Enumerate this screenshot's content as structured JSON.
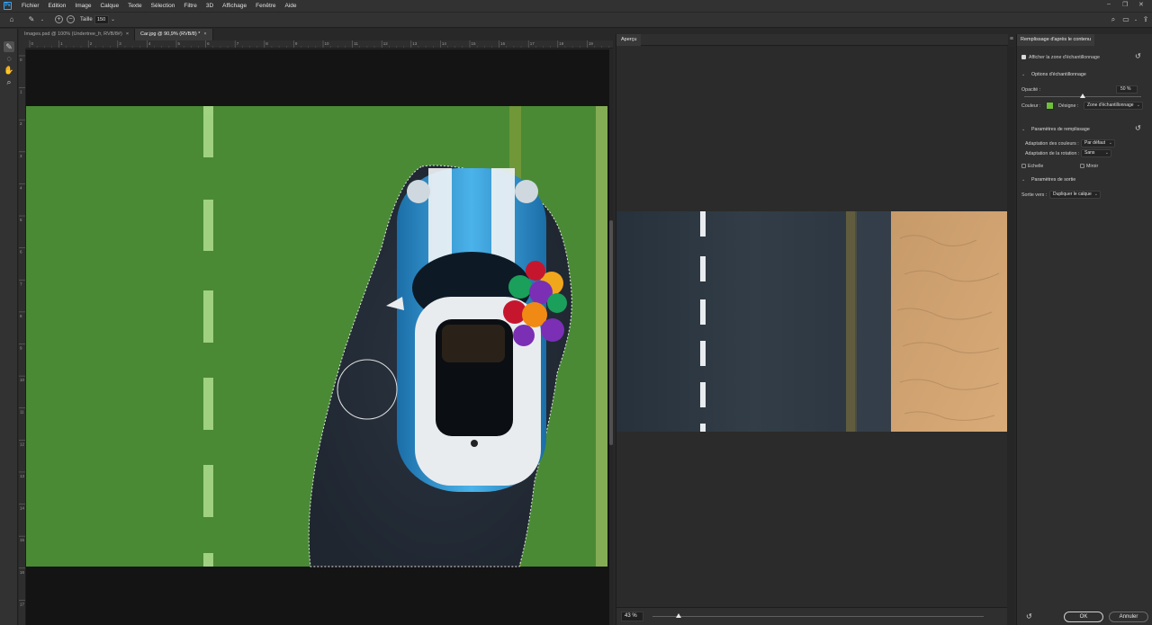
{
  "app": {
    "logo": "Ps"
  },
  "menu": [
    "Fichier",
    "Edition",
    "Image",
    "Calque",
    "Texte",
    "Sélection",
    "Filtre",
    "3D",
    "Affichage",
    "Fenêtre",
    "Aide"
  ],
  "window_controls": {
    "minimize": "–",
    "restore": "❐",
    "close": "✕"
  },
  "options_bar": {
    "size_label": "Taille :",
    "size_value": "150",
    "add_symbol": "+",
    "subtract_symbol": "−"
  },
  "tabs": [
    {
      "label": "Images.psd @ 100% (Undertree_fr, RVB/8#)",
      "close": "×"
    },
    {
      "label": "Car.jpg @ 90,9% (RVB/8) *",
      "close": "×"
    }
  ],
  "ruler_h": [
    "0",
    "1",
    "2",
    "3",
    "4",
    "5",
    "6",
    "7",
    "8",
    "9",
    "10",
    "11",
    "12",
    "13",
    "14",
    "15",
    "16",
    "17",
    "18",
    "19"
  ],
  "ruler_v": [
    "0",
    "1",
    "2",
    "3",
    "4",
    "5",
    "6",
    "7",
    "8",
    "9",
    "10",
    "11",
    "12",
    "13",
    "14",
    "15",
    "16",
    "17"
  ],
  "preview": {
    "tab_label": "Aperçu",
    "zoom_value": "43 %",
    "zoom_fraction": 0.08
  },
  "props": {
    "title": "Remplissage d'après le contenu",
    "show_sample": "Afficher la zone d'échantillonnage",
    "sampling_section": "Options d'échantillonnage",
    "opacity_label": "Opacité :",
    "opacity_value": "50 %",
    "color_label": "Couleur :",
    "color_swatch": "#6fbf3a",
    "indicates_label": "Désigne :",
    "indicates_value": "Zone d'échantillonnage",
    "fill_section": "Paramètres de remplissage",
    "color_adapt_label": "Adaptation des couleurs :",
    "color_adapt_value": "Par défaut",
    "rotation_adapt_label": "Adaptation de la rotation :",
    "rotation_adapt_value": "Sans",
    "scale_label": "Echelle",
    "mirror_label": "Miroir",
    "output_section": "Paramètres de sortie",
    "output_label": "Sortie vers :",
    "output_value": "Dupliquer le calque",
    "ok": "OK",
    "cancel": "Annuler"
  }
}
